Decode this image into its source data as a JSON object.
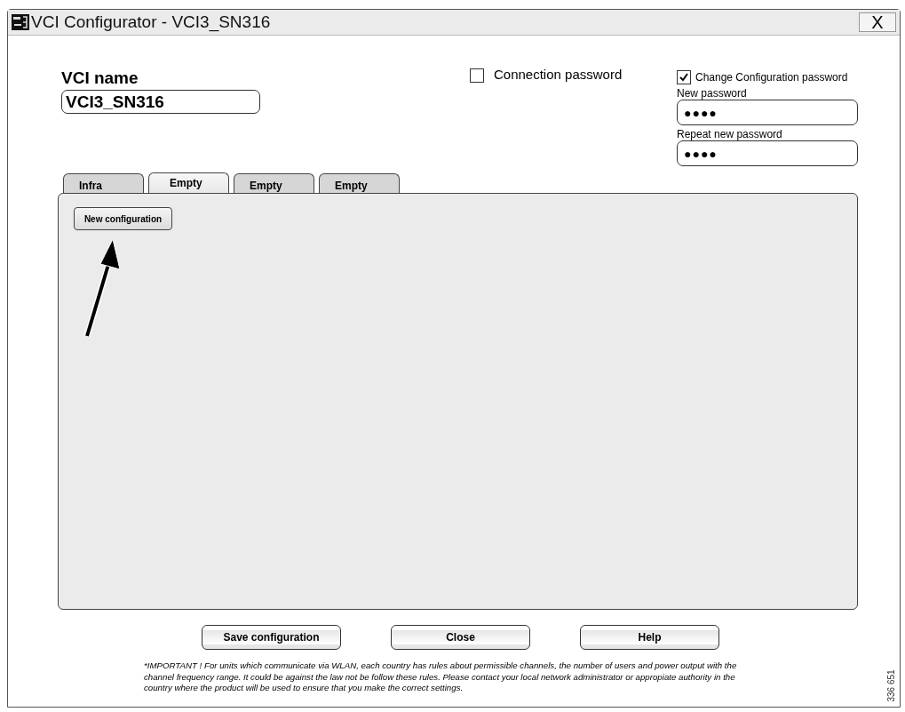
{
  "window": {
    "title": "VCI Configurator - VCI3_SN316",
    "close": "X"
  },
  "vci_name": {
    "label": "VCI name",
    "value": "VCI3_SN316"
  },
  "connection_password": {
    "label": "Connection password",
    "checked": false
  },
  "change_config_password": {
    "label": "Change Configuration password",
    "checked": true,
    "fields": [
      {
        "label": "New password",
        "value": "●●●●"
      },
      {
        "label": "Repeat new password",
        "value": "●●●●"
      }
    ]
  },
  "tabs": [
    {
      "label": "Infra",
      "selected": false
    },
    {
      "label": "Empty",
      "selected": true
    },
    {
      "label": "Empty",
      "selected": false
    },
    {
      "label": "Empty",
      "selected": false
    }
  ],
  "panel": {
    "button": "New configuration"
  },
  "buttons": [
    "Save configuration",
    "Close",
    "Help"
  ],
  "note": "*IMPORTANT ! For units which communicate via WLAN, each country has rules about permissible channels, the number of users and power output with the channel frequency range. It could be against the law not be follow these rules. Please contact your local network administrator or appropiate authority in the country where the product will be used to ensure that you make the correct settings.",
  "figure_number": "336 651"
}
